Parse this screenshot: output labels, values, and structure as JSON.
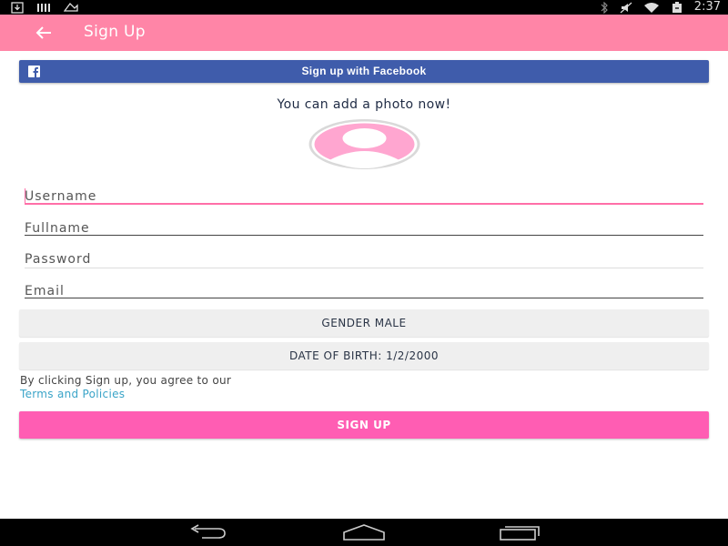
{
  "status_bar": {
    "time": "2:37",
    "left_icons": [
      "download-icon",
      "signal-bars-icon",
      "notification-icon"
    ],
    "right_icons": [
      "bluetooth-icon",
      "mute-icon",
      "wifi-icon",
      "battery-icon"
    ]
  },
  "app_bar": {
    "title": "Sign Up",
    "back_icon": "arrow-left-icon",
    "color": "#ff85a7"
  },
  "facebook_button": {
    "label": "Sign up with Facebook",
    "icon": "facebook-icon",
    "color": "#3f5cab"
  },
  "photo": {
    "prompt": "You can add a photo now!",
    "avatar_icon": "user-avatar-icon"
  },
  "form": {
    "username_placeholder": "Username",
    "fullname_placeholder": "Fullname",
    "password_placeholder": "Password",
    "email_placeholder": "Email",
    "gender_label": "GENDER MALE",
    "dob_label": "DATE OF BIRTH: 1/2/2000"
  },
  "terms": {
    "text": "By clicking Sign up, you agree to our",
    "link": "Terms and Policies"
  },
  "signup_button": {
    "label": "SIGN UP",
    "color": "#ff5db3"
  },
  "nav_bar": {
    "icons": [
      "back-nav-icon",
      "home-nav-icon",
      "recents-nav-icon"
    ]
  }
}
